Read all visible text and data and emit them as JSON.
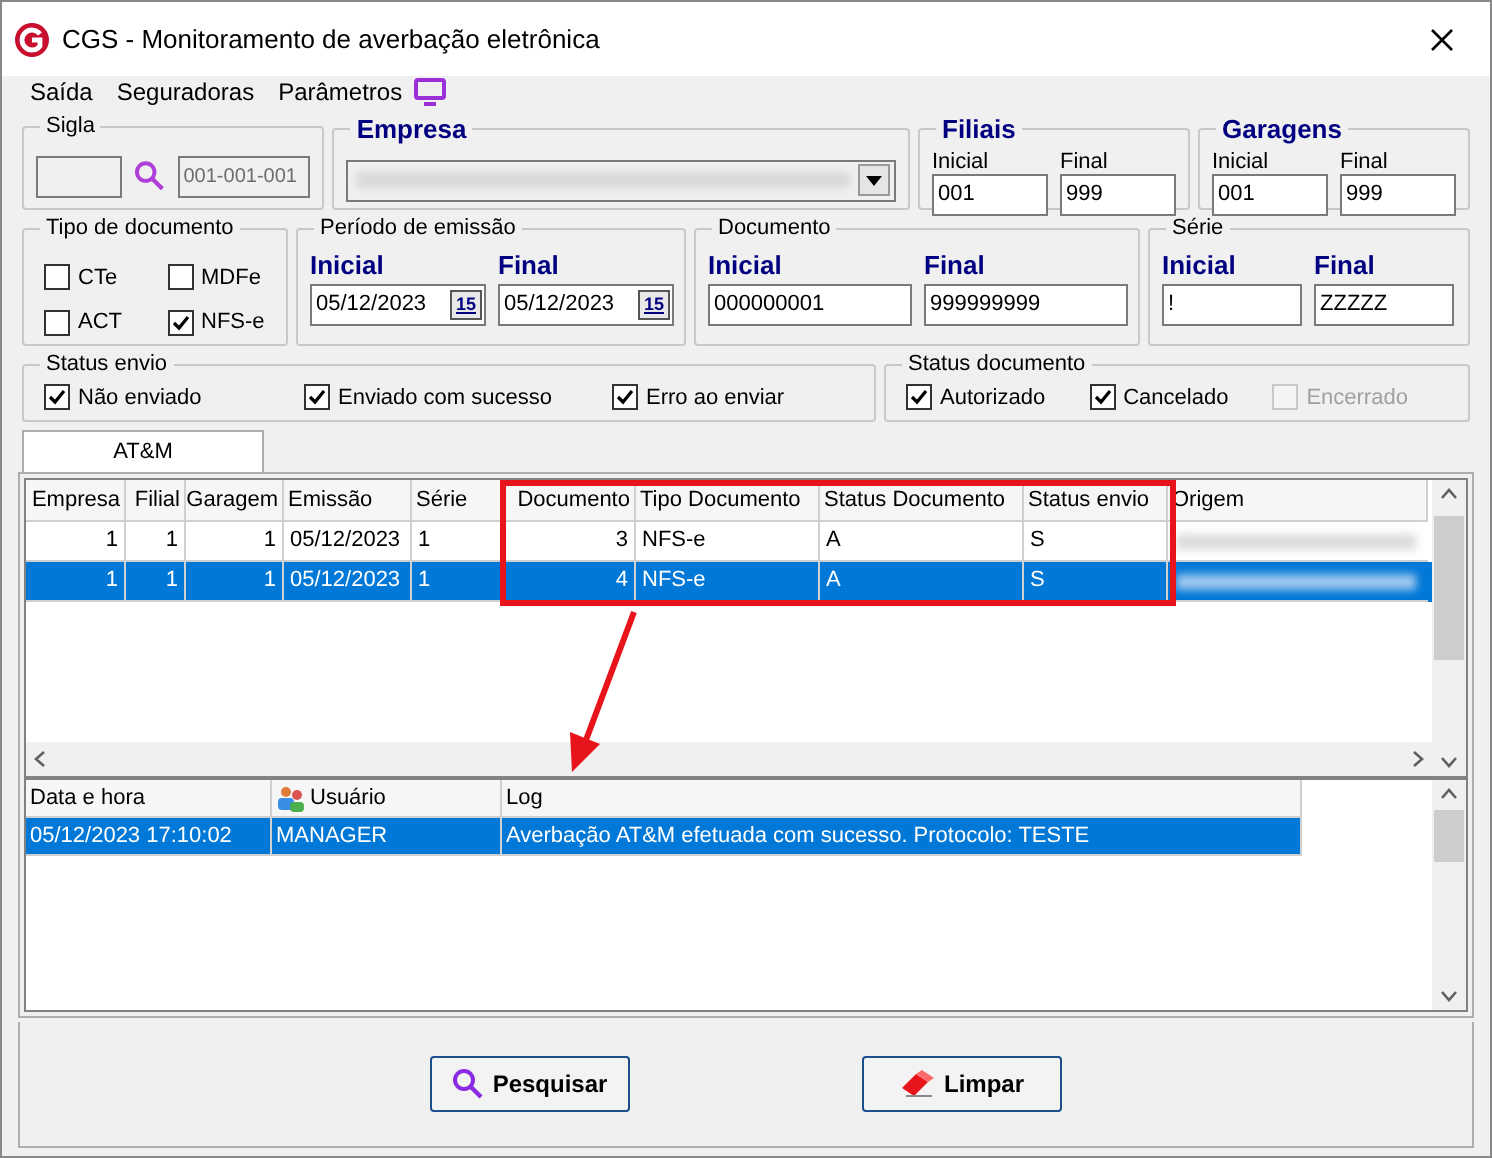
{
  "window": {
    "title": "CGS - Monitoramento de averbação eletrônica"
  },
  "menu": [
    {
      "label": "Saída"
    },
    {
      "label": "Seguradoras"
    },
    {
      "label": "Parâmetros"
    }
  ],
  "sigla": {
    "label": "Sigla",
    "code": "001-001-001"
  },
  "empresa": {
    "label": "Empresa"
  },
  "filiais": {
    "label": "Filiais",
    "inicial_label": "Inicial",
    "final_label": "Final",
    "inicial": "001",
    "final": "999"
  },
  "garagens": {
    "label": "Garagens",
    "inicial_label": "Inicial",
    "final_label": "Final",
    "inicial": "001",
    "final": "999"
  },
  "tipo_documento": {
    "label": "Tipo de documento",
    "options": [
      {
        "label": "CTe",
        "checked": false
      },
      {
        "label": "MDFe",
        "checked": false
      },
      {
        "label": "ACT",
        "checked": false
      },
      {
        "label": "NFS-e",
        "checked": true
      }
    ]
  },
  "periodo": {
    "label": "Período de emissão",
    "inicial_label": "Inicial",
    "final_label": "Final",
    "inicial": "05/12/2023",
    "final": "05/12/2023",
    "inicial_calendar": "15",
    "final_calendar": "15"
  },
  "documento": {
    "label": "Documento",
    "inicial_label": "Inicial",
    "final_label": "Final",
    "inicial": "000000001",
    "final": "999999999"
  },
  "serie": {
    "label": "Série",
    "inicial_label": "Inicial",
    "final_label": "Final",
    "inicial": "!",
    "final": "ZZZZZ"
  },
  "status_envio": {
    "label": "Status envio",
    "options": [
      {
        "label": "Não enviado",
        "checked": true,
        "disabled": false
      },
      {
        "label": "Enviado com sucesso",
        "checked": true,
        "disabled": false
      },
      {
        "label": "Erro ao enviar",
        "checked": true,
        "disabled": false
      }
    ]
  },
  "status_documento": {
    "label": "Status documento",
    "options": [
      {
        "label": "Autorizado",
        "checked": true,
        "disabled": false
      },
      {
        "label": "Cancelado",
        "checked": true,
        "disabled": false
      },
      {
        "label": "Encerrado",
        "checked": false,
        "disabled": true
      }
    ]
  },
  "tabs": [
    {
      "label": "AT&M",
      "selected": true
    }
  ],
  "table": {
    "columns": [
      {
        "label": "Empresa"
      },
      {
        "label": "Filial"
      },
      {
        "label": "Garagem"
      },
      {
        "label": "Emissão"
      },
      {
        "label": "Série"
      },
      {
        "label": "Documento"
      },
      {
        "label": "Tipo Documento"
      },
      {
        "label": "Status Documento"
      },
      {
        "label": "Status envio"
      },
      {
        "label": "Origem"
      }
    ],
    "rows": [
      {
        "selected": false,
        "cells": [
          "1",
          "1",
          "1",
          "05/12/2023",
          "1",
          "3",
          "NFS-e",
          "A",
          "S"
        ]
      },
      {
        "selected": true,
        "cells": [
          "1",
          "1",
          "1",
          "05/12/2023",
          "1",
          "4",
          "NFS-e",
          "A",
          "S"
        ]
      }
    ]
  },
  "log": {
    "columns": [
      {
        "label": "Data e hora"
      },
      {
        "label": "Usuário"
      },
      {
        "label": "Log"
      }
    ],
    "rows": [
      {
        "selected": true,
        "cells": [
          "05/12/2023 17:10:02",
          "MANAGER",
          "Averbação AT&M efetuada com sucesso. Protocolo: TESTE"
        ]
      }
    ]
  },
  "buttons": [
    {
      "label": "Pesquisar",
      "kind": "search"
    },
    {
      "label": "Limpar",
      "kind": "clear"
    }
  ]
}
